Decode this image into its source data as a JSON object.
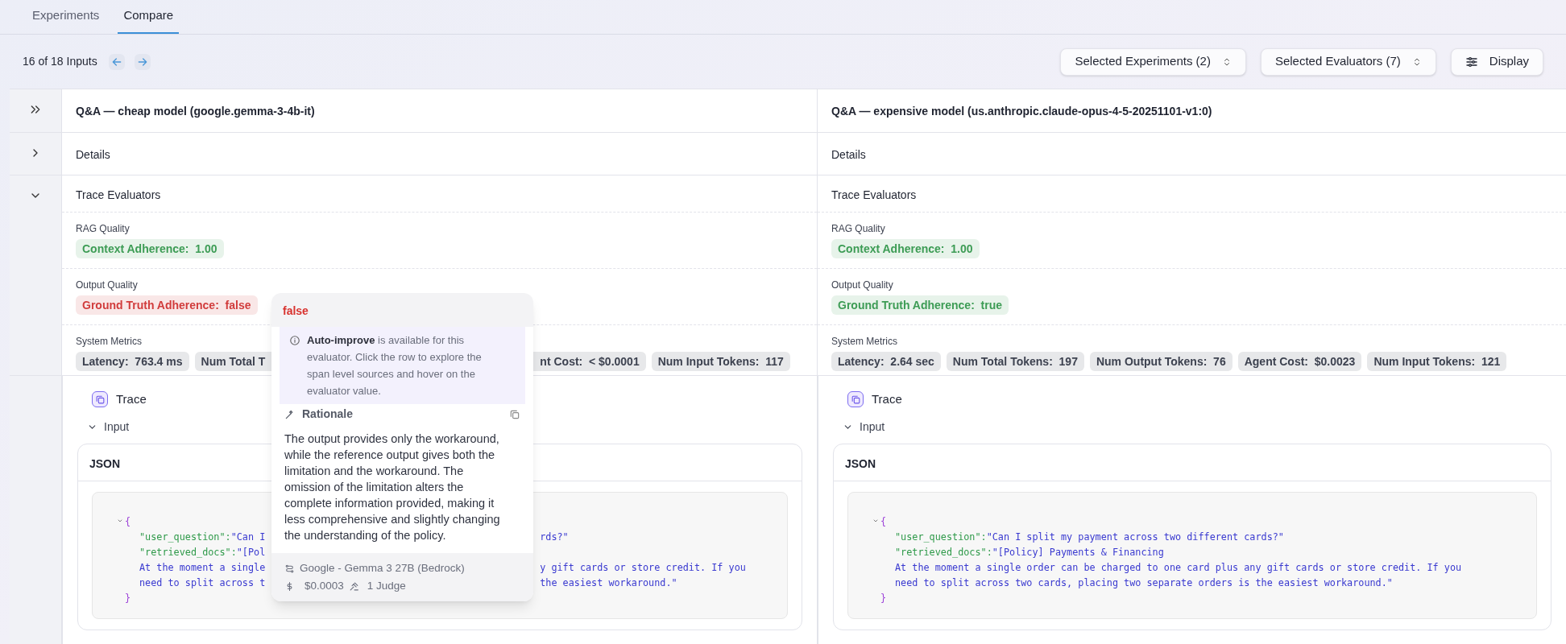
{
  "tabs": [
    {
      "label": "Experiments",
      "selected": false
    },
    {
      "label": "Compare",
      "selected": true
    }
  ],
  "toolbar": {
    "position": "16 of 18 Inputs",
    "buttons": [
      {
        "label": "Selected Experiments (2)",
        "kind": "select"
      },
      {
        "label": "Selected Evaluators (7)",
        "kind": "select"
      },
      {
        "label": "Display",
        "kind": "display"
      }
    ]
  },
  "sections": [
    {
      "kind": "header",
      "expanded": false
    },
    {
      "kind": "details",
      "expanded": false
    },
    {
      "kind": "evaluators",
      "expanded": true
    }
  ],
  "experiments": [
    {
      "title": "Q&A — cheap model (google.gemma-3-4b-it)",
      "details": "Details",
      "evaluators_title": "Trace Evaluators",
      "groups": [
        {
          "title": "RAG Quality",
          "chips": [
            {
              "kind": "full",
              "label": "Context Adherence:",
              "value": "1.00",
              "color": "#3d9c55"
            }
          ]
        },
        {
          "title": "Output Quality",
          "chips": [
            {
              "kind": "full",
              "label": "Ground Truth Adherence:",
              "value": "false",
              "color": "#d13c3c"
            }
          ]
        },
        {
          "title": "System Metrics",
          "chips": [
            {
              "kind": "full",
              "label": "Latency:",
              "value": "763.4 ms",
              "color": "#3d4250"
            },
            {
              "kind": "cut_end",
              "label": "Num Total T",
              "color": "#3d4250"
            },
            {
              "kind": "cut_start",
              "label": "nt Cost:",
              "value": "< $0.0001",
              "color": "#3d4250"
            },
            {
              "kind": "full",
              "label": "Num Input Tokens:",
              "value": "117",
              "color": "#3d4250"
            }
          ]
        }
      ],
      "trace": {
        "title": "Trace",
        "input_label": "Input",
        "expanded": true,
        "card_title": "JSON",
        "lines": [
          {
            "kind": "open",
            "text": "{"
          },
          {
            "kind": "entry",
            "key": "\"user_question\":",
            "value": "\"Can I",
            "tail": "rds?\""
          },
          {
            "kind": "entry",
            "key": "\"retrieved_docs\":",
            "value": "\"[Pol"
          },
          {
            "kind": "text",
            "text": "At the moment a single",
            "tail": "y gift cards or store credit. If you"
          },
          {
            "kind": "text",
            "text": "need to split across t",
            "tail": "the easiest workaround.\""
          },
          {
            "kind": "close",
            "text": "}"
          }
        ]
      }
    },
    {
      "title": "Q&A — expensive model (us.anthropic.claude-opus-4-5-20251101-v1:0)",
      "details": "Details",
      "evaluators_title": "Trace Evaluators",
      "groups": [
        {
          "title": "RAG Quality",
          "chips": [
            {
              "kind": "full",
              "label": "Context Adherence:",
              "value": "1.00",
              "color": "#3d9c55"
            }
          ]
        },
        {
          "title": "Output Quality",
          "chips": [
            {
              "kind": "full",
              "label": "Ground Truth Adherence:",
              "value": "true",
              "color": "#3d9c55"
            }
          ]
        },
        {
          "title": "System Metrics",
          "chips": [
            {
              "kind": "full",
              "label": "Latency:",
              "value": "2.64 sec",
              "color": "#3d4250"
            },
            {
              "kind": "full",
              "label": "Num Total Tokens:",
              "value": "197",
              "color": "#3d4250"
            },
            {
              "kind": "full",
              "label": "Num Output Tokens:",
              "value": "76",
              "color": "#3d4250"
            },
            {
              "kind": "full",
              "label": "Agent Cost:",
              "value": "$0.0023",
              "color": "#3d4250"
            },
            {
              "kind": "full",
              "label": "Num Input Tokens:",
              "value": "121",
              "color": "#3d4250"
            }
          ]
        }
      ],
      "trace": {
        "title": "Trace",
        "input_label": "Input",
        "expanded": true,
        "card_title": "JSON",
        "lines": [
          {
            "kind": "open",
            "text": "{"
          },
          {
            "kind": "entry",
            "key": "\"user_question\":",
            "value": "\"Can I split my payment across two different cards?\""
          },
          {
            "kind": "entry",
            "key": "\"retrieved_docs\":",
            "value": "\"[Policy] Payments & Financing"
          },
          {
            "kind": "text",
            "text": "At the moment a single order can be charged to one card plus any gift cards or store credit. If you"
          },
          {
            "kind": "text",
            "text": "need to split across two cards, placing two separate orders is the easiest workaround.\""
          },
          {
            "kind": "close",
            "text": "}"
          }
        ]
      }
    }
  ],
  "tooltip": {
    "value": "false",
    "color": "#d8322e",
    "notice": "**Auto-improve** is available for this evaluator. Click the row to explore the span level sources and hover on the evaluator value.",
    "rationale_title": "Rationale",
    "rationale": "The output provides only the workaround, while the reference output gives both the limitation and the workaround. The omission of the limitation alters the complete information provided, making it less comprehensive and slightly changing the understanding of the policy.",
    "model": "Google - Gemma 3 27B (Bedrock)",
    "cost": "$0.0003",
    "judges": "1 Judge"
  }
}
